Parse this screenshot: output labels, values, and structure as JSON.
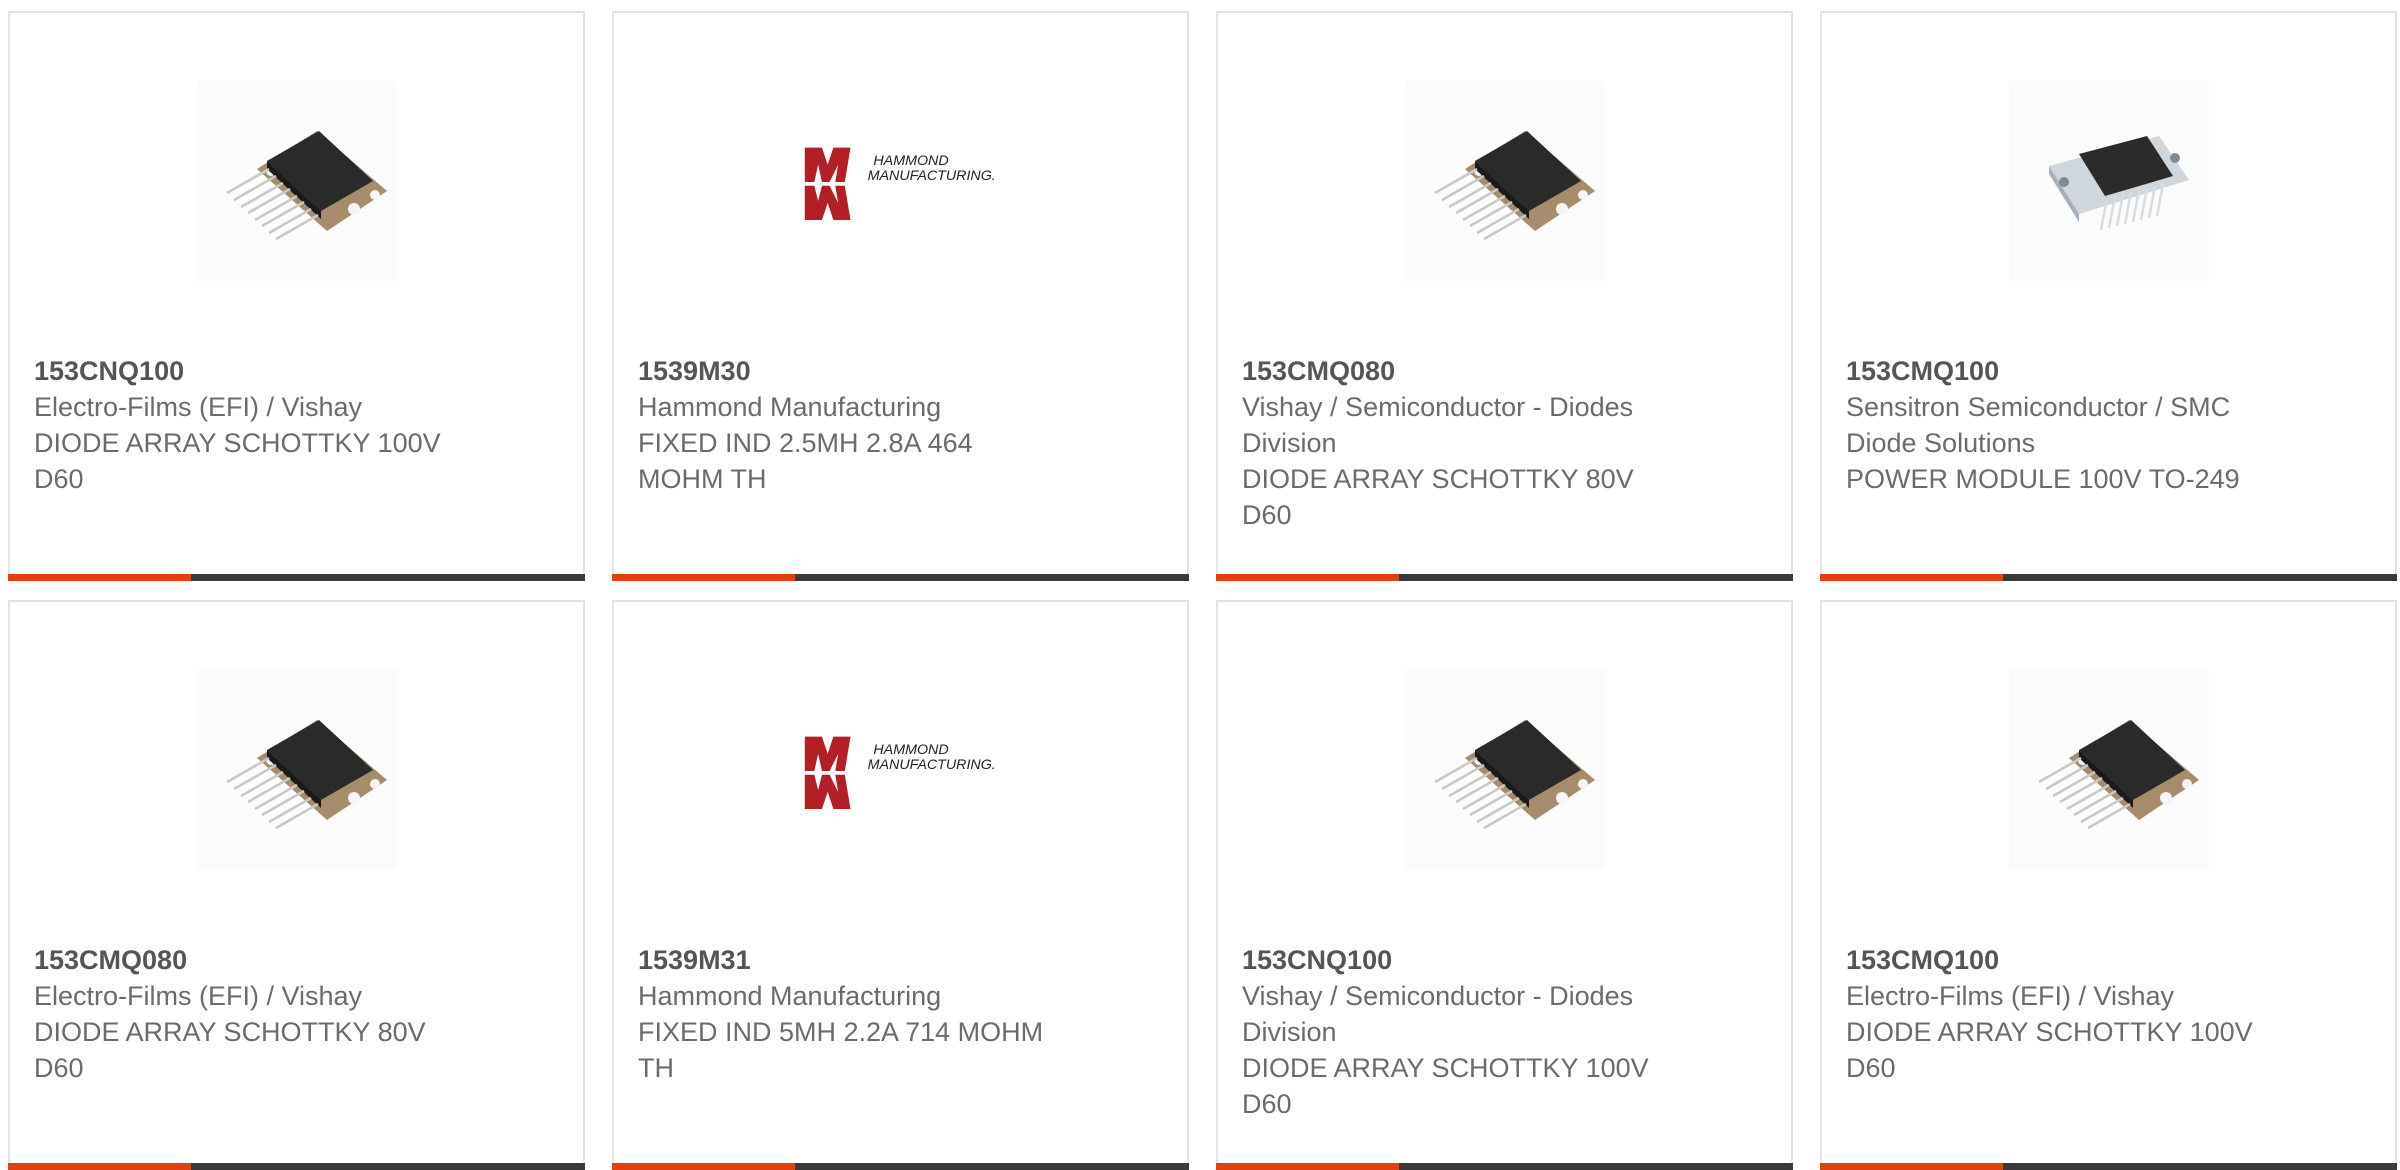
{
  "colors": {
    "accent": "#e4400e",
    "bar": "#3a3a3a",
    "text": "#6b6b6b",
    "title": "#555555"
  },
  "products": [
    {
      "part": "153CNQ100",
      "maker": "Electro-Films (EFI) / Vishay",
      "desc": "DIODE ARRAY SCHOTTKY 100V D60",
      "image": "diode-module-icon"
    },
    {
      "part": "1539M30",
      "maker": "Hammond Manufacturing",
      "desc": "FIXED IND 2.5MH 2.8A 464 MOHM TH",
      "image": "hammond-logo"
    },
    {
      "part": "153CMQ080",
      "maker": "Vishay / Semiconductor - Diodes Division",
      "desc": "DIODE ARRAY SCHOTTKY 80V D60",
      "image": "diode-module-icon"
    },
    {
      "part": "153CMQ100",
      "maker": "Sensitron Semiconductor / SMC Diode Solutions",
      "desc": "POWER MODULE 100V TO-249",
      "image": "power-module-icon"
    },
    {
      "part": "153CMQ080",
      "maker": "Electro-Films (EFI) / Vishay",
      "desc": "DIODE ARRAY SCHOTTKY 80V D60",
      "image": "diode-module-icon"
    },
    {
      "part": "1539M31",
      "maker": "Hammond Manufacturing",
      "desc": "FIXED IND 5MH 2.2A 714 MOHM TH",
      "image": "hammond-logo"
    },
    {
      "part": "153CNQ100",
      "maker": "Vishay / Semiconductor - Diodes Division",
      "desc": "DIODE ARRAY SCHOTTKY 100V D60",
      "image": "diode-module-icon"
    },
    {
      "part": "153CMQ100",
      "maker": "Electro-Films (EFI) / Vishay",
      "desc": "DIODE ARRAY SCHOTTKY 100V D60",
      "image": "diode-module-icon"
    }
  ],
  "logo_text": {
    "line1": "HAMMOND",
    "line2": "MANUFACTURING."
  }
}
